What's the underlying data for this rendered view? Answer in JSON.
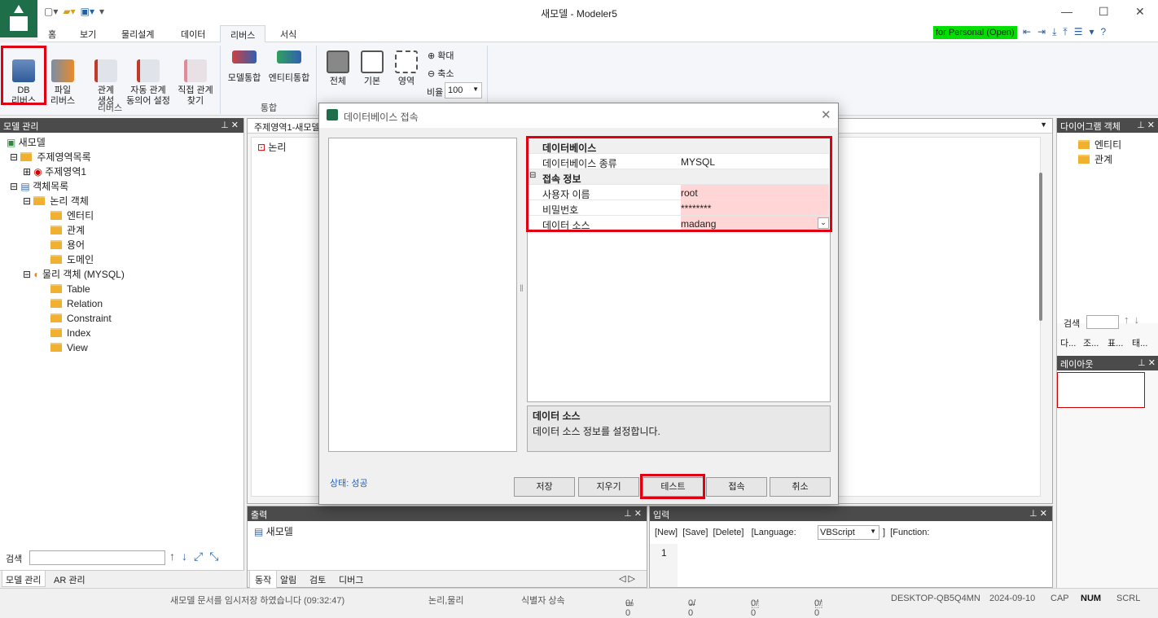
{
  "window": {
    "title": "새모델 - Modeler5",
    "min": "—",
    "max": "☐",
    "close": "✕"
  },
  "menu_tabs": [
    "홈",
    "보기",
    "물리설계",
    "데이터",
    "리버스",
    "서식"
  ],
  "license": "for Personal (Open)",
  "ribbon": {
    "db_reverse": "DB\n리버스",
    "file_reverse": "파일\n리버스",
    "rel_create": "관계\n생성",
    "auto_rel": "자동 관계\n동의어 설정",
    "direct_rel": "직접 관계\n찾기",
    "group_reverse": "리버스",
    "model_merge": "모델통합",
    "entity_merge": "엔티티통합",
    "group_merge": "통합",
    "all": "전체",
    "basic": "기본",
    "area": "영역",
    "zoom_in": "확대",
    "zoom_out": "축소",
    "ratio_label": "비율",
    "ratio_value": "100"
  },
  "left_panel": {
    "title": "모델 관리",
    "tree": [
      "새모델",
      "주제영역목록",
      "주제영역1",
      "객체목록",
      "논리 객체",
      "엔터티",
      "관계",
      "용어",
      "도메인",
      "물리 객체 (MYSQL)",
      "Table",
      "Relation",
      "Constraint",
      "Index",
      "View"
    ],
    "search_label": "검색",
    "tabs": [
      "모델 관리",
      "AR 관리"
    ]
  },
  "center": {
    "doc_tab": "주제영역1-새모델",
    "view_label": "논리"
  },
  "right_panel": {
    "title": "다이어그램 객체",
    "items": [
      "엔티티",
      "관계"
    ],
    "search_label": "검색",
    "tabs": [
      "다...",
      "조...",
      "표...",
      "태..."
    ],
    "layout_title": "레이아웃"
  },
  "output": {
    "title": "출력",
    "item": "새모델",
    "tabs": [
      "동작",
      "알림",
      "검토",
      "디버그"
    ]
  },
  "input": {
    "title": "입력",
    "toolbar": "[New]  [Save]  [Delete]   [Language:",
    "language": "VBScript",
    "function": "]  [Function:",
    "line": "1"
  },
  "dialog": {
    "title": "데이터베이스 접속",
    "section_db": "데이터베이스",
    "db_type_label": "데이터베이스 종류",
    "db_type": "MYSQL",
    "section_conn": "접속 정보",
    "user_label": "사용자 이름",
    "user": "root",
    "pw_label": "비밀번호",
    "pw": "********",
    "ds_label": "데이터 소스",
    "ds": "madang",
    "desc_title": "데이터 소스",
    "desc_text": "데이터 소스 정보를 설정합니다.",
    "status": "상태: 성공",
    "buttons": [
      "저장",
      "지우기",
      "테스트",
      "접속",
      "취소"
    ]
  },
  "status": {
    "msg": "새모델 문서를 임시저장 하였습니다  (09:32:47)",
    "mode": "논리,물리",
    "id": "식별자 상속",
    "c1": "0/  0",
    "c2": "0/  0",
    "c3": "0/  0",
    "c4": "0/  0",
    "host": "DESKTOP-QB5Q4MN",
    "date": "2024-09-10",
    "cap": "CAP",
    "num": "NUM",
    "scrl": "SCRL"
  },
  "colors": {
    "accent": "#1e6e49",
    "highlight": "#e00012",
    "license_bg": "#00e000",
    "field_bg": "#ffd5d5"
  }
}
